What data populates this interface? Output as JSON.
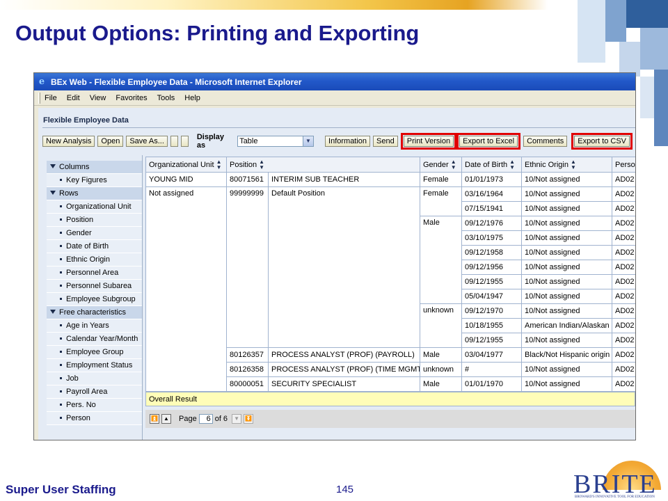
{
  "slide": {
    "title": "Output Options: Printing and Exporting",
    "footer_left": "Super User Staffing",
    "page_number": "145",
    "logo_text": "BRITE",
    "logo_subtitle": "BROWARD'S INNOVATIVE TOOL FOR EDUCATION"
  },
  "window": {
    "title": "BEx Web - Flexible Employee Data - Microsoft Internet Explorer",
    "menu": [
      "File",
      "Edit",
      "View",
      "Favorites",
      "Tools",
      "Help"
    ]
  },
  "app": {
    "header": "Flexible Employee Data",
    "toolbar": {
      "new_analysis": "New Analysis",
      "open": "Open",
      "save_as": "Save As...",
      "display_as_label": "Display as",
      "display_as_value": "Table",
      "information": "Information",
      "send": "Send",
      "print_version": "Print Version",
      "export_excel": "Export to Excel",
      "comments": "Comments",
      "export_csv": "Export to CSV"
    },
    "highlight_color": "#e00000"
  },
  "nav": {
    "columns_head": "Columns",
    "columns": [
      "Key Figures"
    ],
    "rows_head": "Rows",
    "rows": [
      "Organizational Unit",
      "Position",
      "Gender",
      "Date of Birth",
      "Ethnic Origin",
      "Personnel Area",
      "Personnel Subarea",
      "Employee Subgroup"
    ],
    "free_head": "Free characteristics",
    "free": [
      "Age in Years",
      "Calendar Year/Month",
      "Employee Group",
      "Employment Status",
      "Job",
      "Payroll Area",
      "Pers. No",
      "Person"
    ]
  },
  "table": {
    "headers": [
      "Organizational Unit",
      "Position",
      "",
      "Gender",
      "Date of Birth",
      "Ethnic Origin",
      "Perso"
    ],
    "r1": {
      "org": "YOUNG MID",
      "pos": "80071561",
      "posname": "INTERIM SUB TEACHER",
      "gender": "Female",
      "dob": "01/01/1973",
      "eth": "10/Not assigned",
      "pers": "AD02"
    },
    "r2": {
      "org": "Not assigned",
      "pos": "99999999",
      "posname": "Default Position"
    },
    "female2": "Female",
    "male1": "Male",
    "unknown1": "unknown",
    "default_rows": [
      {
        "dob": "03/16/1964",
        "eth": "10/Not assigned",
        "pers": "AD02"
      },
      {
        "dob": "07/15/1941",
        "eth": "10/Not assigned",
        "pers": "AD02"
      },
      {
        "dob": "09/12/1976",
        "eth": "10/Not assigned",
        "pers": "AD02"
      },
      {
        "dob": "03/10/1975",
        "eth": "10/Not assigned",
        "pers": "AD02"
      },
      {
        "dob": "09/12/1958",
        "eth": "10/Not assigned",
        "pers": "AD02"
      },
      {
        "dob": "09/12/1956",
        "eth": "10/Not assigned",
        "pers": "AD02"
      },
      {
        "dob": "09/12/1955",
        "eth": "10/Not assigned",
        "pers": "AD02"
      },
      {
        "dob": "05/04/1947",
        "eth": "10/Not assigned",
        "pers": "AD02"
      },
      {
        "dob": "09/12/1970",
        "eth": "10/Not assigned",
        "pers": "AD02"
      },
      {
        "dob": "10/18/1955",
        "eth": "American Indian/Alaskan",
        "pers": "AD02"
      },
      {
        "dob": "09/12/1955",
        "eth": "10/Not assigned",
        "pers": "AD02"
      }
    ],
    "r3": {
      "pos": "80126357",
      "posname": "PROCESS ANALYST (PROF) (PAYROLL)",
      "gender": "Male",
      "dob": "03/04/1977",
      "eth": "Black/Not Hispanic origin",
      "pers": "AD02"
    },
    "r4": {
      "pos": "80126358",
      "posname": "PROCESS ANALYST (PROF) (TIME MGMT)",
      "gender": "unknown",
      "dob": "#",
      "eth": "10/Not assigned",
      "pers": "AD02"
    },
    "r5": {
      "pos": "80000051",
      "posname": "SECURITY SPECIALIST",
      "gender": "Male",
      "dob": "01/01/1970",
      "eth": "10/Not assigned",
      "pers": "AD02"
    },
    "overall": "Overall Result"
  },
  "pager": {
    "label": "Page",
    "current": "6",
    "of": "of 6"
  }
}
